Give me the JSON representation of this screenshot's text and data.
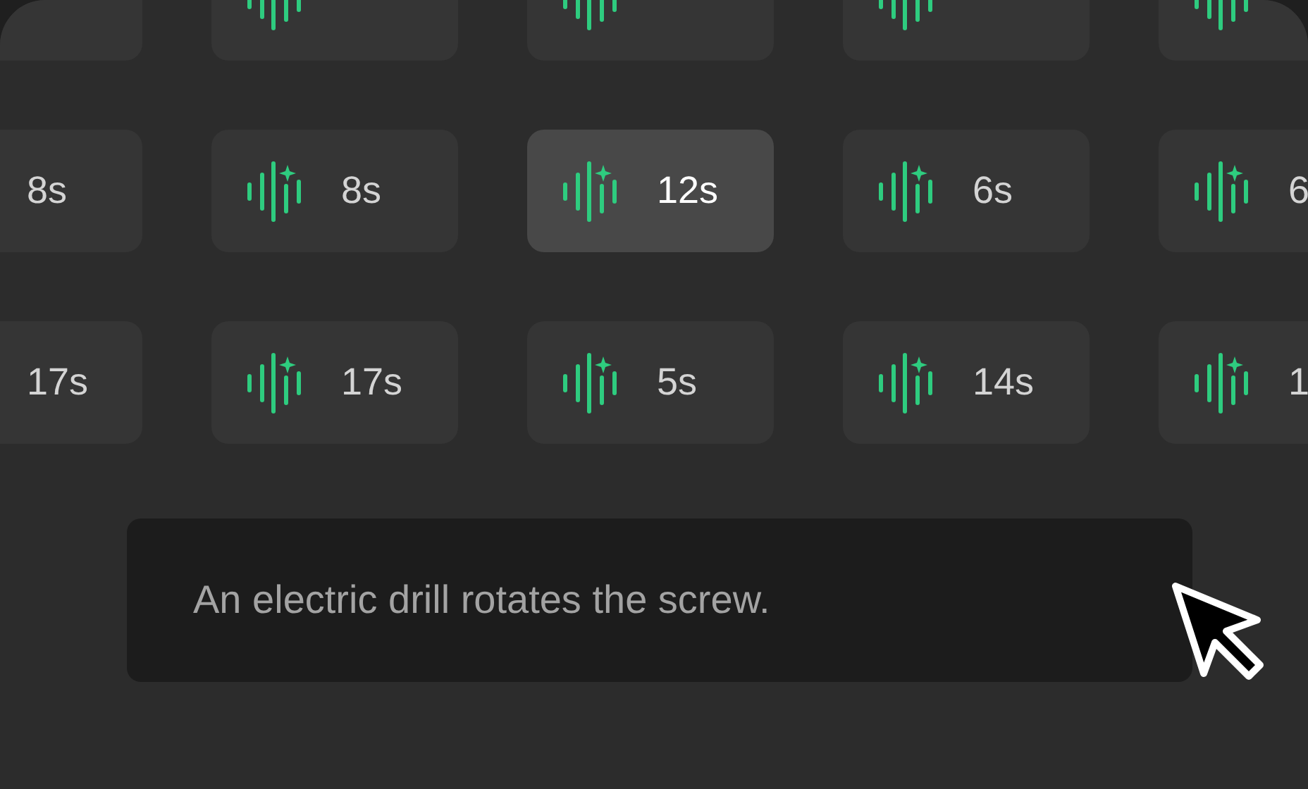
{
  "rows": [
    {
      "cards": [
        {
          "selected": false
        },
        {
          "selected": false
        },
        {
          "selected": false
        },
        {
          "selected": false
        },
        {
          "selected": false
        }
      ]
    },
    {
      "cards": [
        {
          "duration": "8s",
          "selected": false
        },
        {
          "duration": "8s",
          "selected": false
        },
        {
          "duration": "12s",
          "selected": true
        },
        {
          "duration": "6s",
          "selected": false
        },
        {
          "duration": "6",
          "selected": false
        }
      ]
    },
    {
      "cards": [
        {
          "duration": "17s",
          "selected": false
        },
        {
          "duration": "17s",
          "selected": false
        },
        {
          "duration": "5s",
          "selected": false
        },
        {
          "duration": "14s",
          "selected": false
        },
        {
          "duration": "1",
          "selected": false
        }
      ]
    }
  ],
  "caption": "An electric drill rotates the screw."
}
